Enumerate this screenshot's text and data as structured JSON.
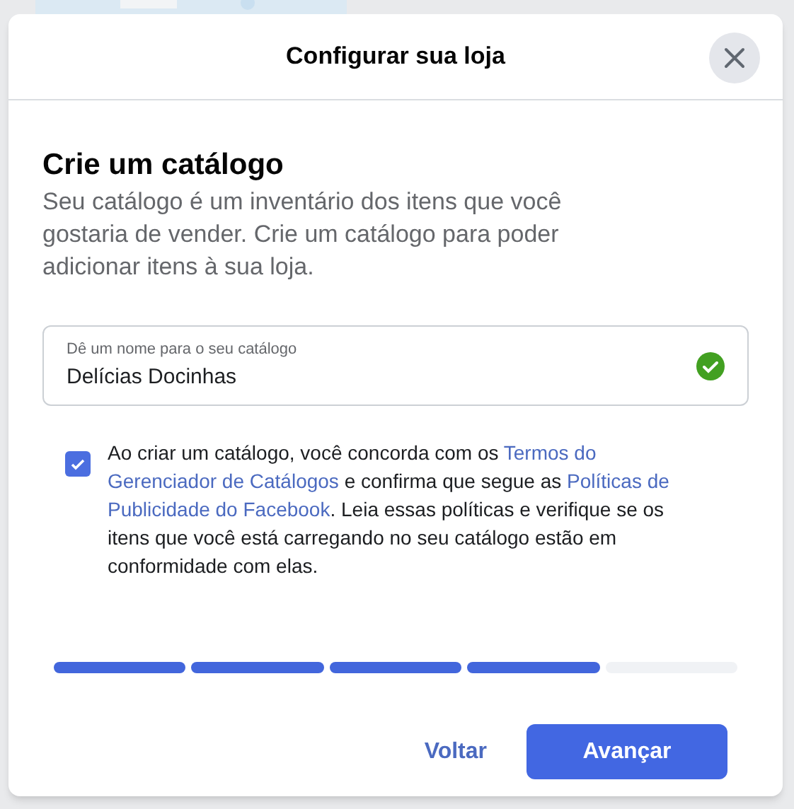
{
  "dialog": {
    "title": "Configurar sua loja"
  },
  "heading": "Crie um catálogo",
  "description": "Seu catálogo é um inventário dos itens que você gostaria de vender. Crie um catálogo para poder adicionar itens à sua loja.",
  "name_field": {
    "label": "Dê um nome para o seu catálogo",
    "value": "Delícias Docinhas",
    "valid": true
  },
  "agreement": {
    "checked": true,
    "segments": [
      {
        "kind": "text",
        "text": "Ao criar um catálogo, você concorda com os "
      },
      {
        "kind": "link",
        "text": "Termos do Gerenciador de Catálogos"
      },
      {
        "kind": "text",
        "text": " e confirma que segue as "
      },
      {
        "kind": "link",
        "text": "Políticas de Publicidade do Facebook"
      },
      {
        "kind": "text",
        "text": ". Leia essas políticas e verifique se os itens que você está carregando no seu catálogo estão em conformidade com elas."
      }
    ]
  },
  "progress": [
    {
      "done": true
    },
    {
      "done": true
    },
    {
      "done": true
    },
    {
      "done": true
    },
    {
      "done": false
    }
  ],
  "buttons": {
    "back": "Voltar",
    "next": "Avançar"
  }
}
